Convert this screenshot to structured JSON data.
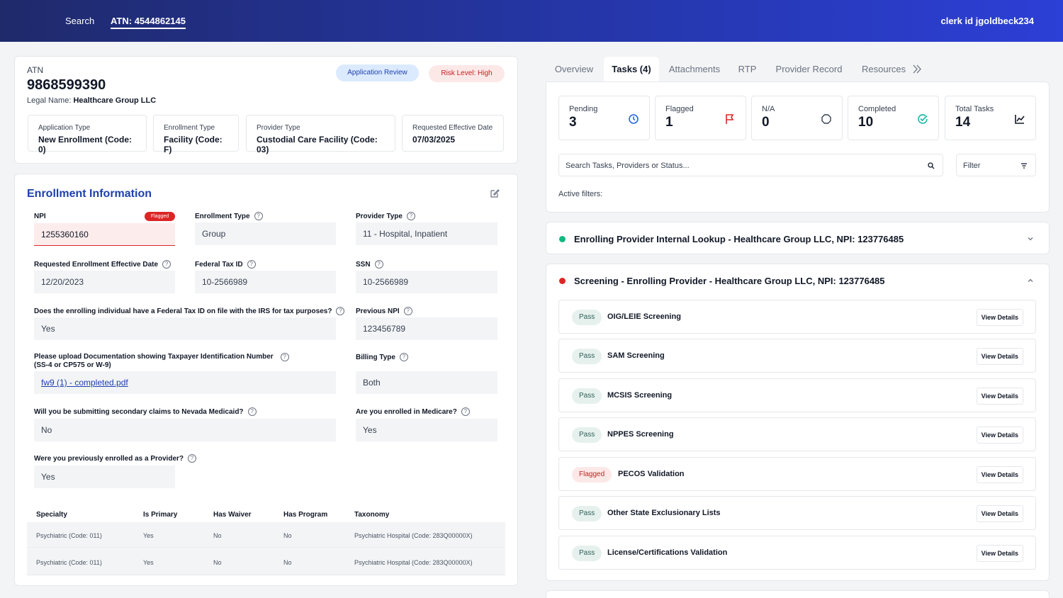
{
  "topbar": {
    "search": "Search",
    "atn": "ATN: 4544862145",
    "clerk": "clerk id jgoldbeck234"
  },
  "summary": {
    "atn_label": "ATN",
    "atn_value": "9868599390",
    "legal_label": "Legal Name:",
    "legal_value": "Healthcare Group LLC",
    "badge_status": "Application Review",
    "badge_risk": "Risk Level: High",
    "info": [
      {
        "label": "Application Type",
        "value": "New Enrollment (Code: 0)"
      },
      {
        "label": "Enrollment Type",
        "value": "Facility (Code: F)"
      },
      {
        "label": "Provider Type",
        "value": "Custodial Care Facility (Code: 03)"
      },
      {
        "label": "Requested Effective Date",
        "value": "07/03/2025"
      }
    ]
  },
  "enrollment": {
    "title": "Enrollment Information",
    "npi_label": "NPI",
    "npi_flag": "Flagged",
    "npi_value": "1255360160",
    "enrollment_type_label": "Enrollment Type",
    "enrollment_type_value": "Group",
    "provider_type_label": "Provider Type",
    "provider_type_value": "11 - Hospital, Inpatient",
    "req_date_label": "Requested Enrollment Effective Date",
    "req_date_value": "12/20/2023",
    "fed_tax_label": "Federal Tax ID",
    "fed_tax_value": "10-2566989",
    "ssn_label": "SSN",
    "ssn_value": "10-2566989",
    "irs_q": "Does the enrolling individual have a Federal Tax ID on file with the IRS for tax purposes?",
    "irs_a": "Yes",
    "prev_npi_label": "Previous NPI",
    "prev_npi_value": "123456789",
    "upload_q1": "Please upload Documentation showing Taxpayer Identification Number",
    "upload_q2": "(SS-4 or CP575 or W-9)",
    "upload_file": "fw9 (1) - completed.pdf",
    "billing_label": "Billing Type",
    "billing_value": "Both",
    "nevada_q": "Will you be submitting secondary claims to Nevada Medicaid?",
    "nevada_a": "No",
    "medicare_q": "Are you enrolled in Medicare?",
    "medicare_a": "Yes",
    "prev_provider_q": "Were you previously enrolled as a Provider?",
    "prev_provider_a": "Yes",
    "table": {
      "headers": [
        "Specialty",
        "Is Primary",
        "Has Waiver",
        "Has Program",
        "Taxonomy"
      ],
      "rows": [
        [
          "Psychiatric (Code: 011)",
          "Yes",
          "No",
          "No",
          "Psychiatric Hospital (Code: 283Q00000X)"
        ],
        [
          "Psychiatric (Code: 011)",
          "Yes",
          "No",
          "No",
          "Psychiatric Hospital (Code: 283Q00000X)"
        ]
      ]
    }
  },
  "tabs": [
    "Overview",
    "Tasks (4)",
    "Attachments",
    "RTP",
    "Provider Record",
    "Resources"
  ],
  "stats": [
    {
      "label": "Pending",
      "value": "3",
      "icon": "clock-icon",
      "color": "#2563eb"
    },
    {
      "label": "Flagged",
      "value": "1",
      "icon": "flag-icon",
      "color": "#dc2626"
    },
    {
      "label": "N/A",
      "value": "0",
      "icon": "octagon-icon",
      "color": "#374151"
    },
    {
      "label": "Completed",
      "value": "10",
      "icon": "check-circle-icon",
      "color": "#14b8a6"
    },
    {
      "label": "Total Tasks",
      "value": "14",
      "icon": "chart-icon",
      "color": "#111827"
    }
  ],
  "search": {
    "placeholder": "Search Tasks, Providers or Status...",
    "filter": "Filter",
    "active_filters": "Active filters:"
  },
  "groups": [
    {
      "title": "Enrolling Provider Internal Lookup - Healthcare Group LLC, NPI: 123776485",
      "color": "#10b981"
    },
    {
      "title": "Screening - Enrolling Provider - Healthcare Group LLC, NPI: 123776485",
      "color": "#dc2626"
    }
  ],
  "tasks": [
    {
      "status": "Pass",
      "name": "OIG/LEIE Screening",
      "action": "View Details"
    },
    {
      "status": "Pass",
      "name": "SAM Screening",
      "action": "View Details"
    },
    {
      "status": "Pass",
      "name": "MCSIS Screening",
      "action": "View Details"
    },
    {
      "status": "Pass",
      "name": "NPPES Screening",
      "action": "View Details"
    },
    {
      "status": "Flagged",
      "name": "PECOS Validation",
      "action": "View Details"
    },
    {
      "status": "Pass",
      "name": "Other State Exclusionary Lists",
      "action": "View Details"
    },
    {
      "status": "Pass",
      "name": "License/Certifications Validation",
      "action": "View Details"
    }
  ]
}
